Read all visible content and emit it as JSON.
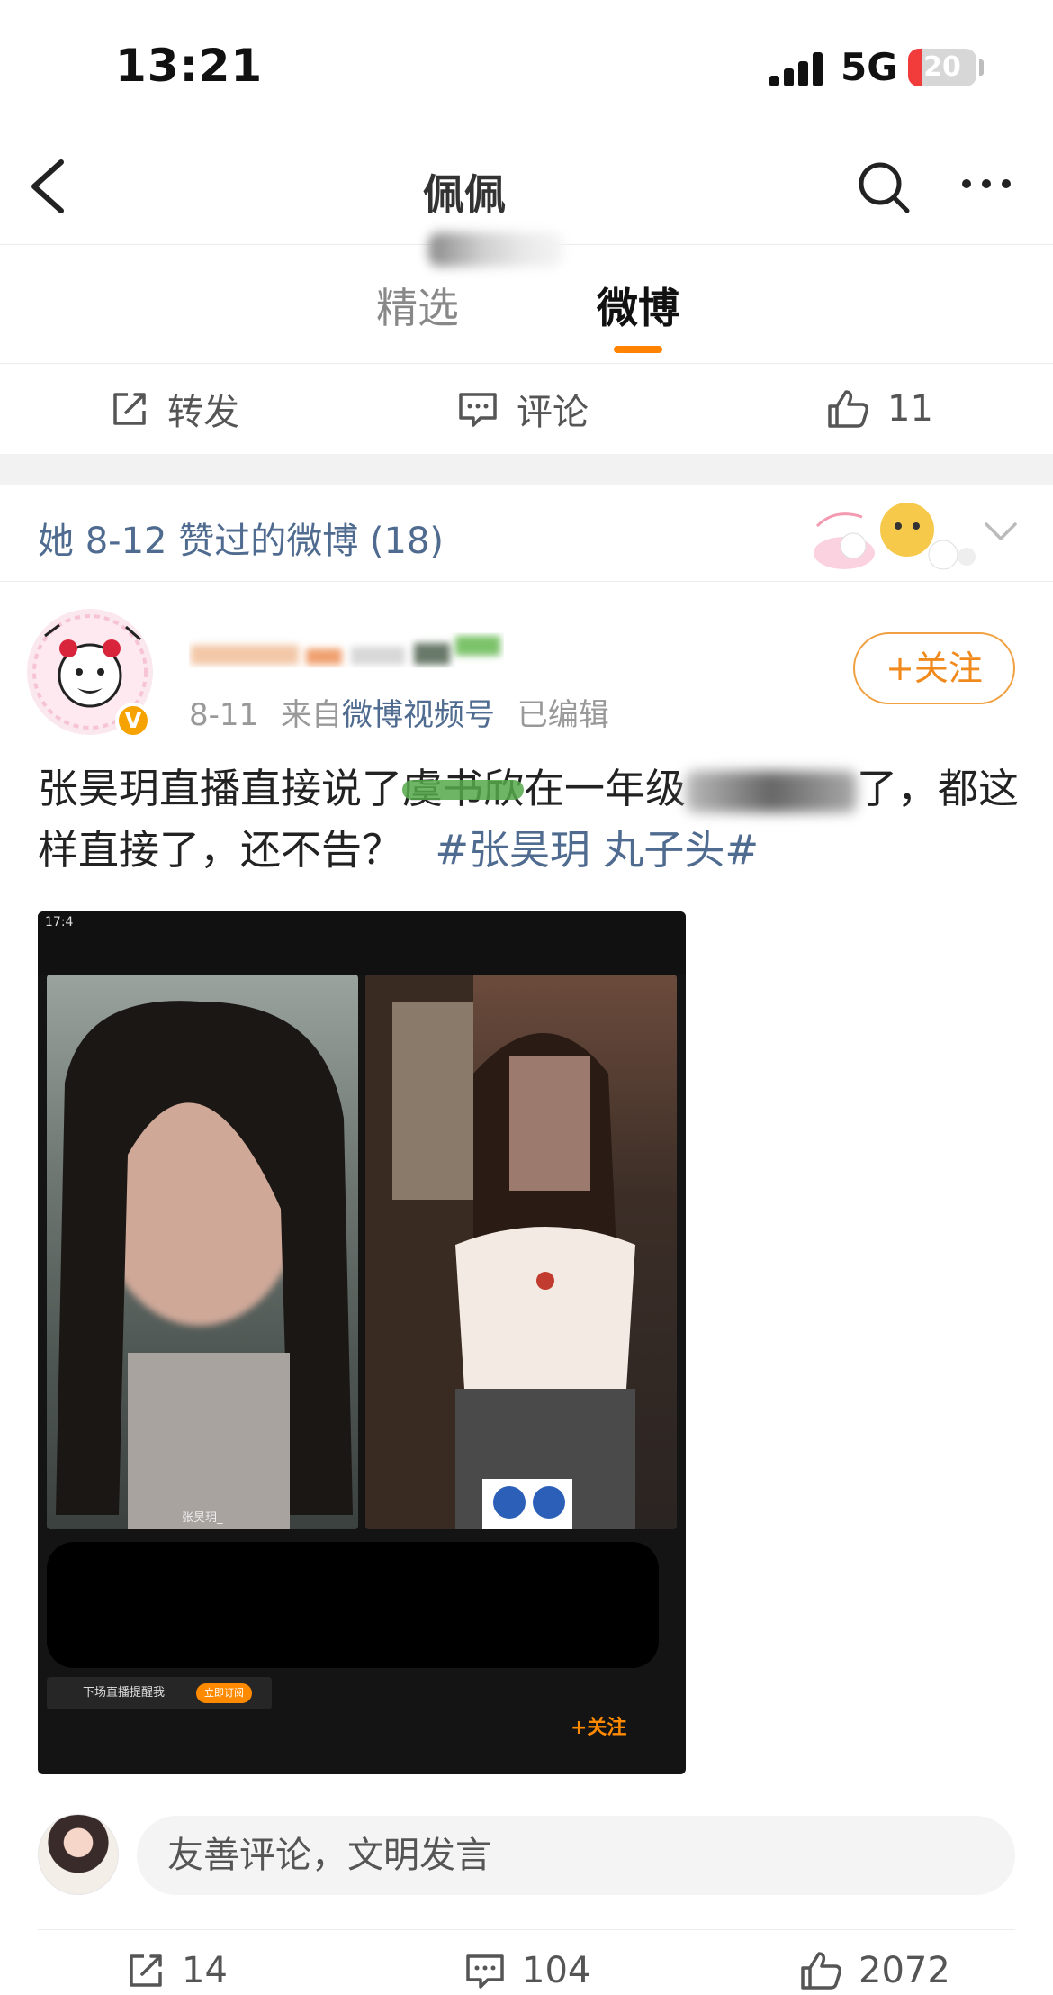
{
  "status": {
    "time": "13:21",
    "network": "5G",
    "battery": "20",
    "battery_level": 0.2
  },
  "nav": {
    "title": "佩佩",
    "icons": [
      "back-arrow-icon",
      "search-icon",
      "more-icon"
    ]
  },
  "tabs": [
    {
      "label": "精选",
      "active": false
    },
    {
      "label": "微博",
      "active": true
    }
  ],
  "prev_actions": {
    "repost": "转发",
    "comment": "评论",
    "like_count": "11"
  },
  "liked_header": {
    "text": "她 8-12 赞过的微博 (18)"
  },
  "post": {
    "date": "8-11",
    "source_prefix": "来自",
    "source": "微博视频号",
    "edited": "已编辑",
    "follow": "+关注",
    "text_part1": "张昊玥直播直接说了",
    "text_marked": "虞书欣",
    "text_part2": "在一年级",
    "text_part3": "了，都这样直接了，还不告？",
    "topic": "#张昊玥 丸子头#"
  },
  "media": {
    "time": "17:4",
    "left_name": "张昊玥_",
    "remind": "下场直播提醒我",
    "subscribe": "立即订阅",
    "follow": "+关注"
  },
  "comment": {
    "placeholder": "友善评论，文明发言"
  },
  "footer": {
    "repost_count": "14",
    "comment_count": "104",
    "like_count": "2072"
  },
  "colors": {
    "accent": "#ff8200",
    "link": "#4f6b8f",
    "text": "#222222"
  }
}
